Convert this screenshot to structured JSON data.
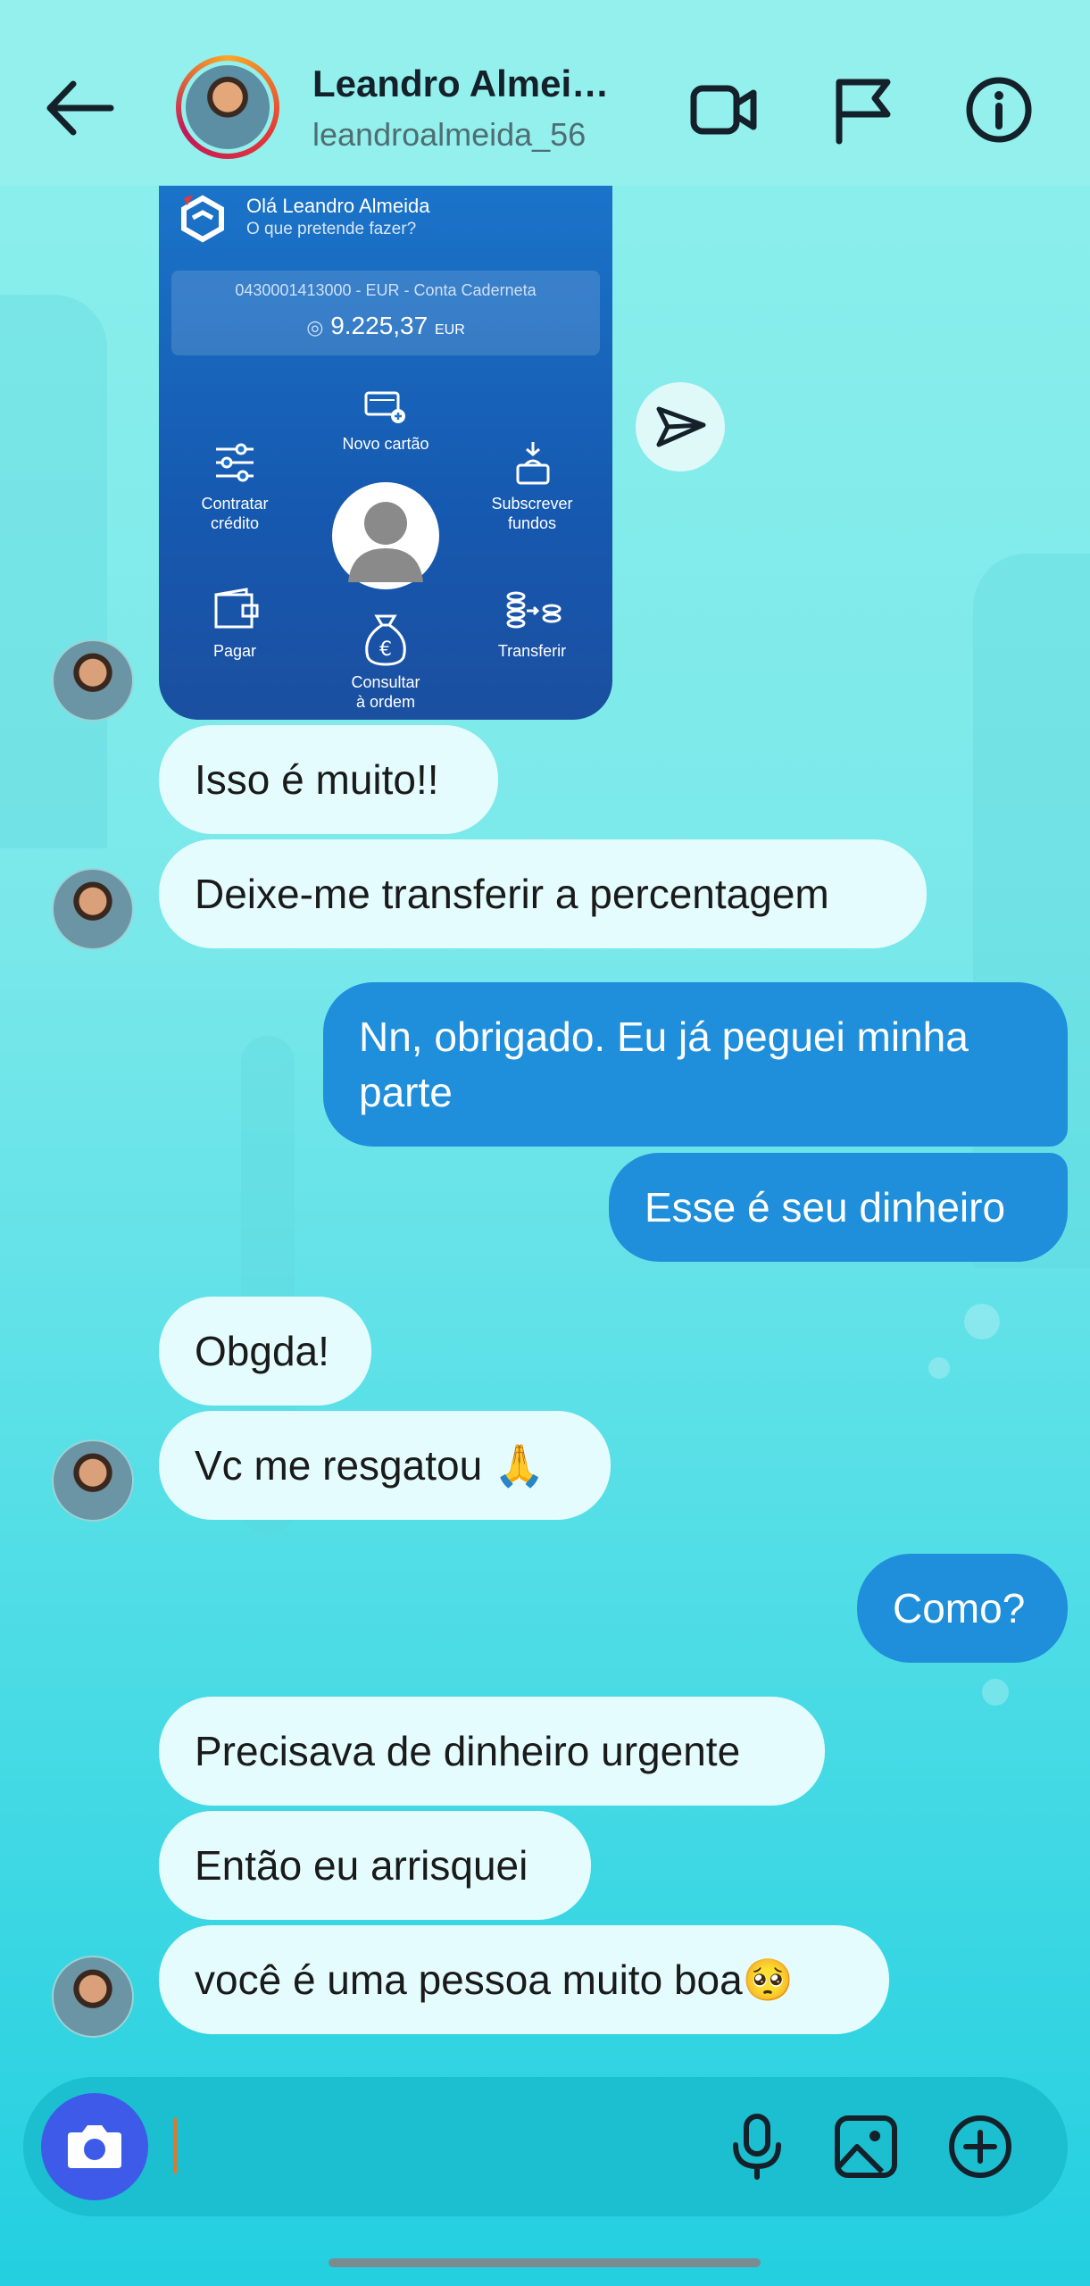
{
  "header": {
    "name": "Leandro Almei…",
    "username": "leandroalmeida_56"
  },
  "shared_screenshot": {
    "greeting": "Olá Leandro Almeida",
    "prompt": "O que pretende fazer?",
    "account": "0430001413000 - EUR - Conta Caderneta",
    "balance": "9.225,37",
    "currency": "EUR",
    "actions": {
      "new_card": "Novo cartão",
      "credit": "Contratar\ncrédito",
      "funds": "Subscrever\nfundos",
      "pay": "Pagar",
      "consult": "Consultar\nà ordem",
      "transfer": "Transferir"
    }
  },
  "messages": [
    {
      "from": "them",
      "text": "Isso é muito!!"
    },
    {
      "from": "them",
      "text": "Deixe-me transferir a percentagem"
    },
    {
      "from": "me",
      "text": "Nn, obrigado. Eu já peguei minha parte"
    },
    {
      "from": "me",
      "text": "Esse é seu dinheiro"
    },
    {
      "from": "them",
      "text": "Obgda!"
    },
    {
      "from": "them",
      "text": "Vc me resgatou 🙏"
    },
    {
      "from": "me",
      "text": "Como?"
    },
    {
      "from": "them",
      "text": "Precisava de dinheiro urgente"
    },
    {
      "from": "them",
      "text": "Então eu arrisquei"
    },
    {
      "from": "them",
      "text": "você é uma pessoa muito boa🥺"
    }
  ],
  "colors": {
    "background": "#7ae8ea",
    "outgoing_bubble": "#1f8fdb",
    "incoming_bubble": "#e4fcfd",
    "camera_button": "#3d5be8"
  },
  "icons": {
    "back": "arrow-left",
    "video": "video-camera",
    "report": "flag",
    "info": "info-circle",
    "share": "paper-plane",
    "camera": "camera",
    "mic": "microphone",
    "gallery": "image",
    "more": "plus-circle"
  }
}
